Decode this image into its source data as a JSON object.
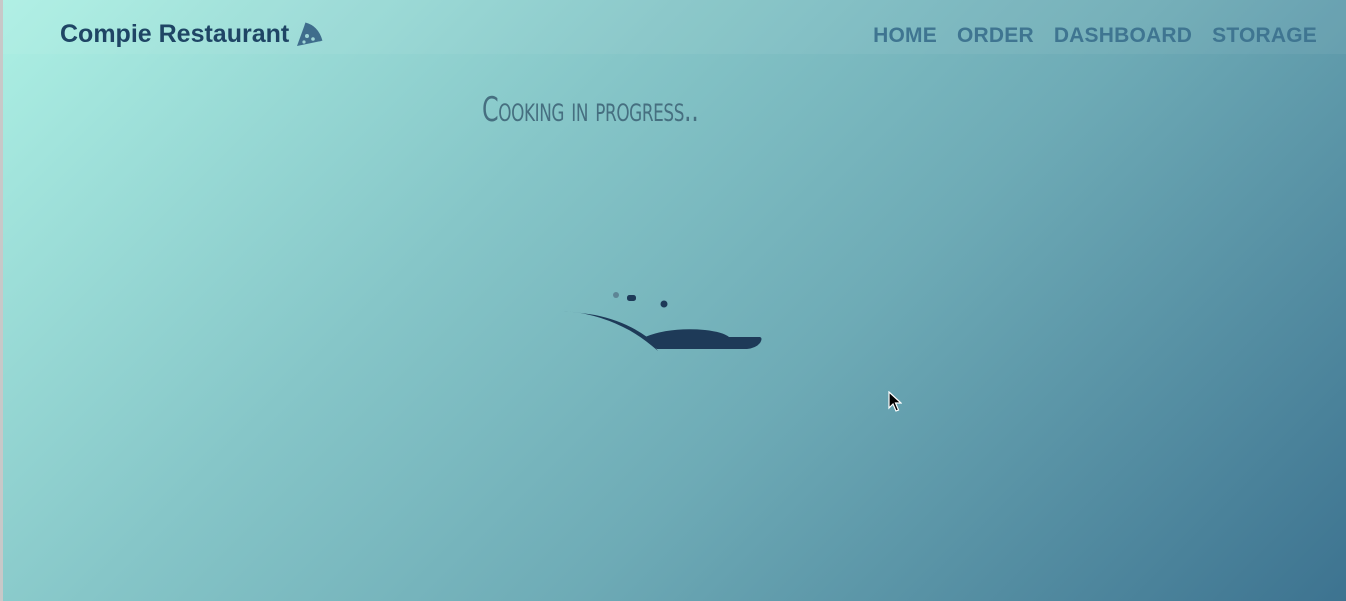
{
  "brand": {
    "title": "Compie Restaurant",
    "icon": "pizza-slice-icon"
  },
  "nav": {
    "items": [
      {
        "label": "HOME"
      },
      {
        "label": "ORDER"
      },
      {
        "label": "DASHBOARD"
      },
      {
        "label": "STORAGE"
      }
    ]
  },
  "main": {
    "status_text": "Cooking in progress..",
    "loader_icon": "frying-pan-icon"
  },
  "colors": {
    "brand": "#1f4565",
    "nav_link": "#3f7591",
    "pan": "#1e3a58",
    "gradient_start": "#adf0e4",
    "gradient_end": "#3d7390"
  }
}
